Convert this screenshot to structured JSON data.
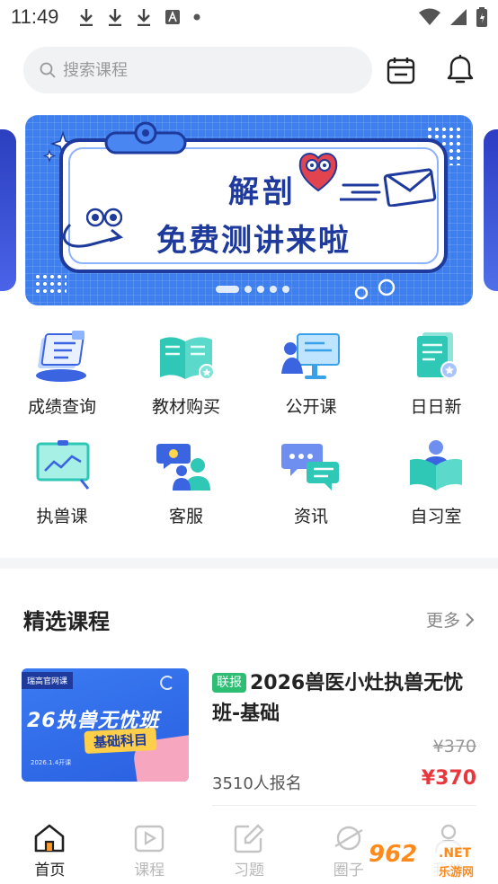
{
  "status_bar": {
    "time": "11:49"
  },
  "search": {
    "placeholder": "搜索课程"
  },
  "banner": {
    "line1": "解剖",
    "line2": "免费测讲来啦"
  },
  "quick_grid": [
    {
      "label": "成绩查询",
      "icon": "score-query-icon"
    },
    {
      "label": "教材购买",
      "icon": "textbook-icon"
    },
    {
      "label": "公开课",
      "icon": "open-class-icon"
    },
    {
      "label": "日日新",
      "icon": "daily-new-icon"
    },
    {
      "label": "执兽课",
      "icon": "vet-course-icon"
    },
    {
      "label": "客服",
      "icon": "customer-service-icon"
    },
    {
      "label": "资讯",
      "icon": "news-icon"
    },
    {
      "label": "自习室",
      "icon": "study-room-icon"
    }
  ],
  "section": {
    "title": "精选课程",
    "more": "更多"
  },
  "course": {
    "thumb_tag": "瑞高官网课",
    "thumb_big": "26执兽无忧班",
    "thumb_sub": "基础科目",
    "thumb_date": "2026.1.4开课",
    "badge": "联报",
    "title": "2026兽医小灶执兽无忧班-基础",
    "original_price": "¥370",
    "enrolled": "3510人报名",
    "price": "¥370"
  },
  "bottom_nav": [
    {
      "label": "首页",
      "active": true
    },
    {
      "label": "课程",
      "active": false
    },
    {
      "label": "习题",
      "active": false
    },
    {
      "label": "圈子",
      "active": false
    },
    {
      "label": "我的",
      "active": false
    }
  ],
  "watermark": {
    "num": "962",
    "net": ".NET",
    "cn": "乐游网"
  },
  "colors": {
    "brand_blue": "#3e7ff0",
    "price_red": "#e8383d",
    "badge_green": "#2dbe73",
    "teal": "#2fc7b5"
  }
}
